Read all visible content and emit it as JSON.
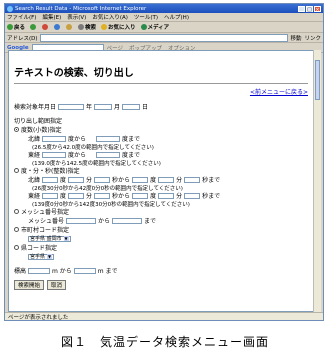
{
  "window": {
    "title": "Search Result Data - Microsoft Internet Explorer",
    "menu": [
      "ファイル(F)",
      "編集(E)",
      "表示(V)",
      "お気に入り(A)",
      "ツール(T)",
      "ヘルプ(H)"
    ],
    "toolbar": [
      "戻る",
      "検索",
      "お気に入り",
      "メディア"
    ],
    "address_label": "アドレス(D)",
    "go_label": "移動",
    "links_label": "リンク",
    "google_label": "Google",
    "google_links": [
      "ページ",
      "ポップアップ",
      "オプション"
    ],
    "status": "ページが表示されました"
  },
  "page": {
    "title": "テキストの検索、切り出し",
    "back_link": "<前メニューに戻る>",
    "date_label": "検索対象年月日",
    "year": "年",
    "month": "月",
    "day": "日",
    "range_label": "切り出し範囲指定",
    "opt_degree": "度数(小数)指定",
    "lat_label": "北緯",
    "lon_label": "東経",
    "from": "度から",
    "to": "度まで",
    "lat_hint": "(26.5度から42.0度の範囲内で指定してください)",
    "lon_hint": "(139.0度から142.5度の範囲内で指定してください)",
    "opt_dms": "度・分・秒(整数)指定",
    "deg": "度",
    "min": "分",
    "sec_from": "秒から",
    "sec_to": "秒まで",
    "lat_hint2": "(26度30分0秒から42度0分0秒の範囲内で指定してください)",
    "lon_hint2": "(139度0分0秒から142度30分0秒の範囲内で指定してください)",
    "opt_mesh": "メッシュ番号指定",
    "mesh_label": "メッシュ番号",
    "mesh_from": "から",
    "mesh_to": "まで",
    "opt_city": "市町村コード指定",
    "city_value": "宮手県 盛岡市",
    "opt_pref": "県コード指定",
    "pref_value": "宮手県",
    "elev_label": "標高",
    "elev_from": "m から",
    "elev_to": "m まで",
    "submit": "検索開始",
    "cancel": "取消"
  },
  "caption": "図１　気温データ検索メニュー画面"
}
